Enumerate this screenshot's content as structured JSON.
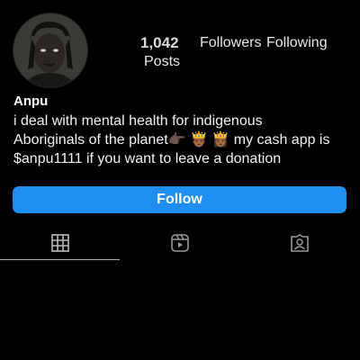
{
  "profile": {
    "posts_count": "1,042",
    "posts_label": "Posts",
    "followers_label": "Followers",
    "following_label": "Following",
    "name": "Anpu",
    "bio_lines": [
      "i deal with mental health for indigenous",
      "Aboriginals of the planet👉🏿 🤴🏾 👸🏾 my cash app is",
      "$anpu1111 if you want to leave a donation"
    ]
  },
  "actions": {
    "follow_label": "Follow"
  },
  "tabs": [
    {
      "icon": "grid-icon",
      "active": true
    },
    {
      "icon": "reels-icon",
      "active": false
    },
    {
      "icon": "tagged-icon",
      "active": false
    }
  ],
  "colors": {
    "background": "#000000",
    "follow_button": "#1f8ef1",
    "text": "#ffffff"
  }
}
